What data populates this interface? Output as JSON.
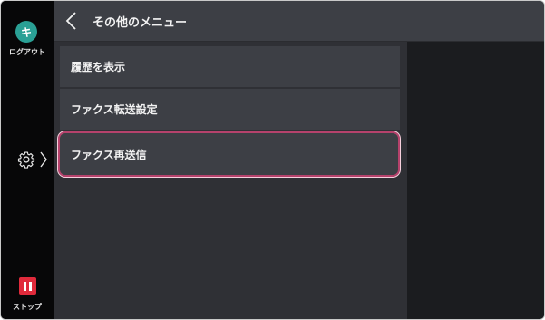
{
  "rail": {
    "login_glyph": "キ",
    "login_label": "ログアウト",
    "settings_icon": "gear-icon",
    "stop_label": "ストップ"
  },
  "header": {
    "title": "その他のメニュー"
  },
  "menu": {
    "items": [
      {
        "label": "履歴を表示"
      },
      {
        "label": "ファクス転送設定"
      },
      {
        "label": "ファクス再送信",
        "selected": true
      }
    ]
  },
  "colors": {
    "accent_login": "#2aa095",
    "stop": "#e02a3b",
    "selection_border": "#b6426c"
  }
}
